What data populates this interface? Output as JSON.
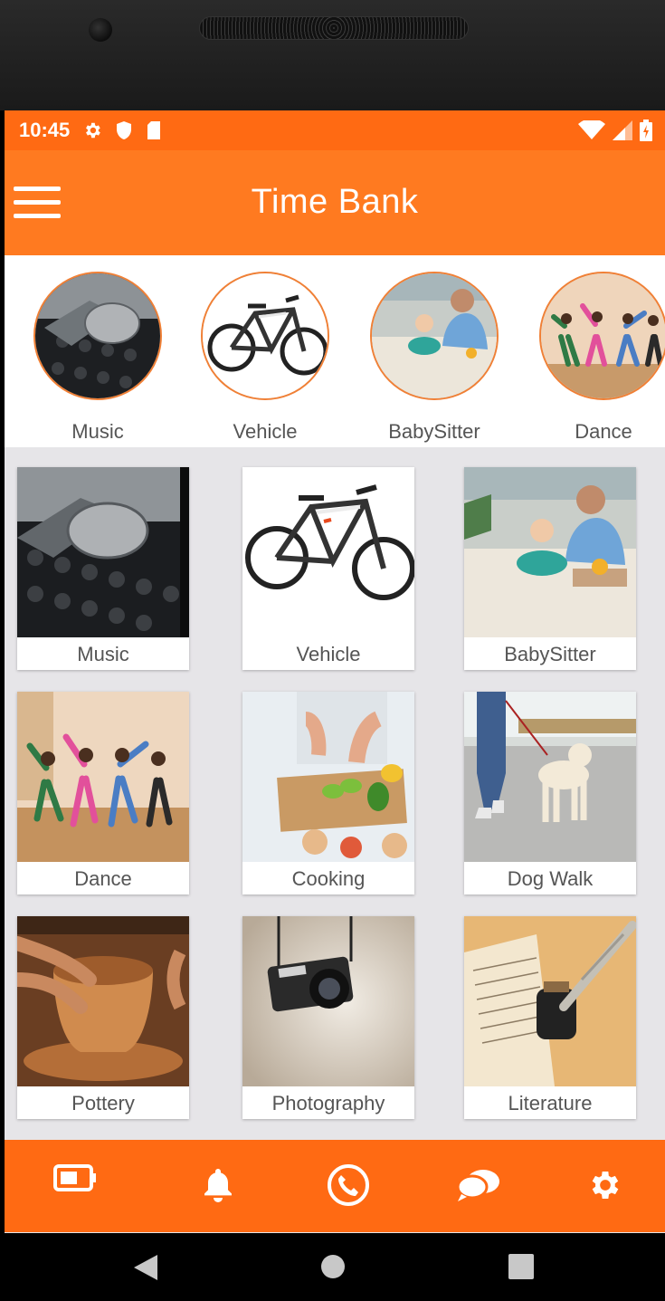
{
  "status_bar": {
    "time": "10:45",
    "left_icons": [
      "gear-icon",
      "shield-icon",
      "sd-card-icon"
    ],
    "right_icons": [
      "wifi-icon",
      "signal-icon",
      "battery-icon"
    ]
  },
  "app_bar": {
    "title": "Time Bank",
    "menu_icon": "hamburger-menu-icon"
  },
  "categories_row": [
    {
      "label": "Music"
    },
    {
      "label": "Vehicle"
    },
    {
      "label": "BabySitter"
    },
    {
      "label": "Dance"
    }
  ],
  "grid": [
    {
      "label": "Music"
    },
    {
      "label": "Vehicle"
    },
    {
      "label": "BabySitter"
    },
    {
      "label": "Dance"
    },
    {
      "label": "Cooking"
    },
    {
      "label": "Dog Walk"
    },
    {
      "label": "Pottery"
    },
    {
      "label": "Photography"
    },
    {
      "label": "Literature"
    }
  ],
  "bottom_nav": [
    "wallet-icon",
    "bell-icon",
    "phone-icon",
    "chat-icon",
    "gear-icon"
  ],
  "system_nav": [
    "back-icon",
    "home-icon",
    "recents-icon"
  ],
  "colors": {
    "accent": "#ff6a13",
    "app_bar": "#ff7a20",
    "circle_border": "#f08036",
    "background": "#e6e5e8"
  }
}
